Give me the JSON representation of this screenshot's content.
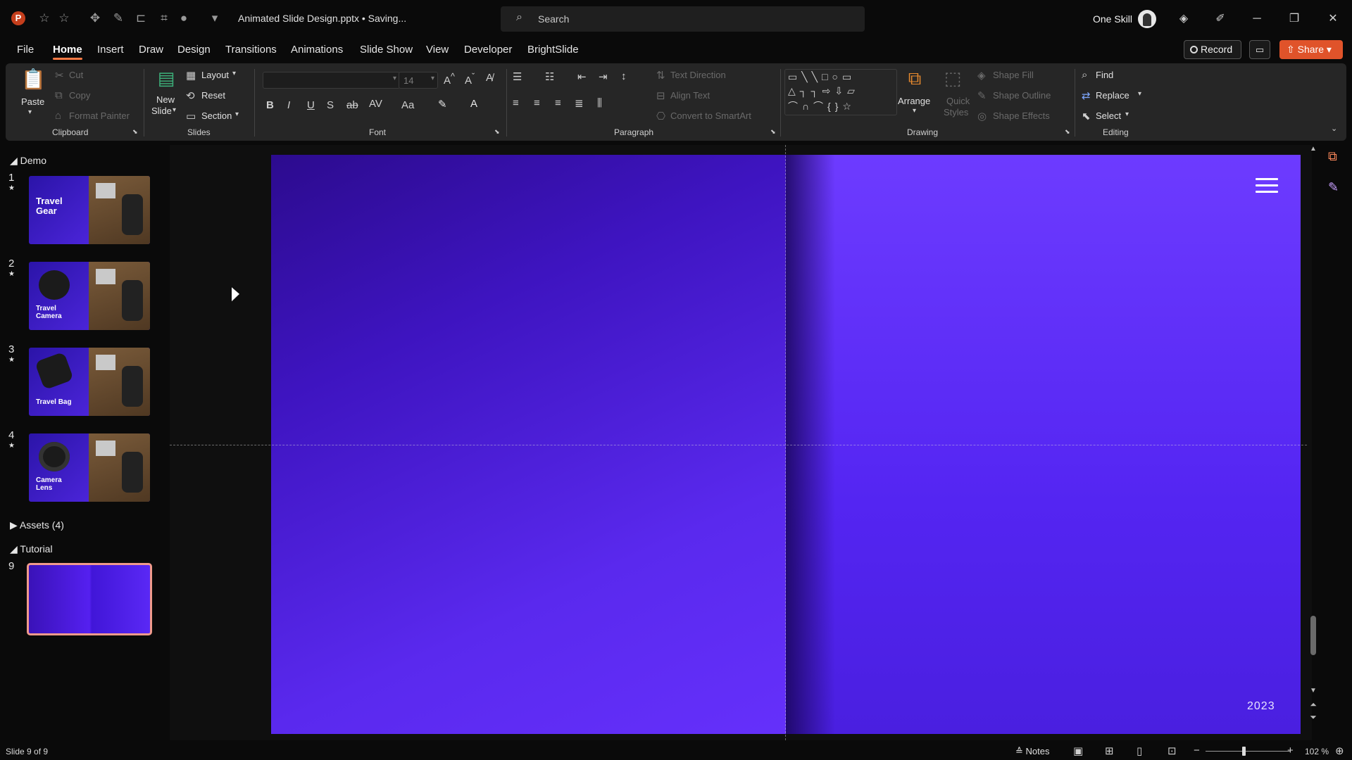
{
  "app": {
    "logo": "P",
    "doc_title": "Animated Slide Design.pptx  •  Saving...",
    "user_name": "One Skill"
  },
  "search": {
    "placeholder": "Search"
  },
  "tabs": [
    "File",
    "Home",
    "Insert",
    "Draw",
    "Design",
    "Transitions",
    "Animations",
    "Slide Show",
    "View",
    "Developer",
    "BrightSlide"
  ],
  "active_tab": "Home",
  "actions": {
    "record": "Record",
    "share": "Share"
  },
  "ribbon": {
    "clipboard": {
      "paste": "Paste",
      "cut": "Cut",
      "copy": "Copy",
      "format_painter": "Format Painter",
      "label": "Clipboard"
    },
    "slides": {
      "new_slide": "New",
      "new_slide2": "Slide",
      "layout": "Layout",
      "reset": "Reset",
      "section": "Section",
      "label": "Slides"
    },
    "font": {
      "size": "14",
      "label": "Font"
    },
    "paragraph": {
      "text_direction": "Text Direction",
      "align_text": "Align Text",
      "convert_smartart": "Convert to SmartArt",
      "label": "Paragraph"
    },
    "drawing": {
      "arrange": "Arrange",
      "quick_styles": "Quick",
      "quick_styles2": "Styles",
      "shape_fill": "Shape Fill",
      "shape_outline": "Shape Outline",
      "shape_effects": "Shape Effects",
      "label": "Drawing"
    },
    "editing": {
      "find": "Find",
      "replace": "Replace",
      "select": "Select",
      "label": "Editing"
    }
  },
  "sections": [
    {
      "title": "Demo"
    },
    {
      "title": "Assets (4)"
    },
    {
      "title": "Tutorial"
    }
  ],
  "slides": [
    {
      "num": "1",
      "label": "Travel Gear"
    },
    {
      "num": "2",
      "label": "Travel Camera"
    },
    {
      "num": "3",
      "label": "Travel Bag"
    },
    {
      "num": "4",
      "label": "Camera Lens"
    },
    {
      "num": "9",
      "label": ""
    }
  ],
  "slide": {
    "year": "2023"
  },
  "status": {
    "slide_info": "Slide 9 of 9",
    "notes": "Notes",
    "zoom": "102 %",
    "zoom_level_percent": 102
  },
  "colors": {
    "accent": "#e0532a",
    "slide_purple": "#4a1fe0",
    "active_thumb_border": "#f09a8c"
  }
}
